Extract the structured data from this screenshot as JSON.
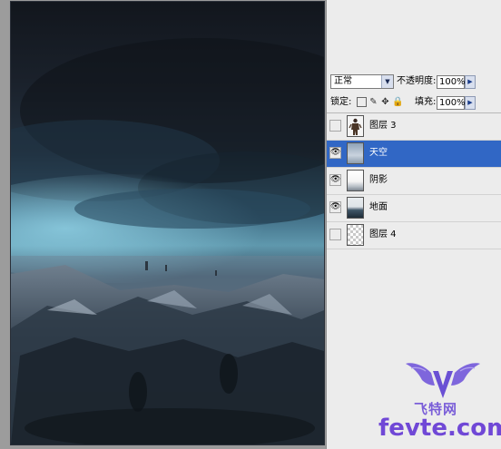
{
  "layers_panel": {
    "blend_mode": "正常",
    "opacity_label": "不透明度:",
    "opacity_value": "100%",
    "lock_label": "锁定:",
    "fill_label": "填充:",
    "fill_value": "100%",
    "layers": [
      {
        "name": "图层 3",
        "visible": false,
        "selected": false,
        "thumb": "figure"
      },
      {
        "name": "天空",
        "visible": true,
        "selected": true,
        "thumb": "sky"
      },
      {
        "name": "阴影",
        "visible": true,
        "selected": false,
        "thumb": "shadow"
      },
      {
        "name": "地面",
        "visible": true,
        "selected": false,
        "thumb": "ground"
      },
      {
        "name": "图层 4",
        "visible": false,
        "selected": false,
        "thumb": "checker"
      }
    ]
  },
  "watermark": {
    "chinese": "飞特网",
    "url": "fevte.com"
  },
  "colors": {
    "selected_layer": "#3167c5",
    "panel_bg": "#ececec",
    "watermark": "#7048d6"
  }
}
